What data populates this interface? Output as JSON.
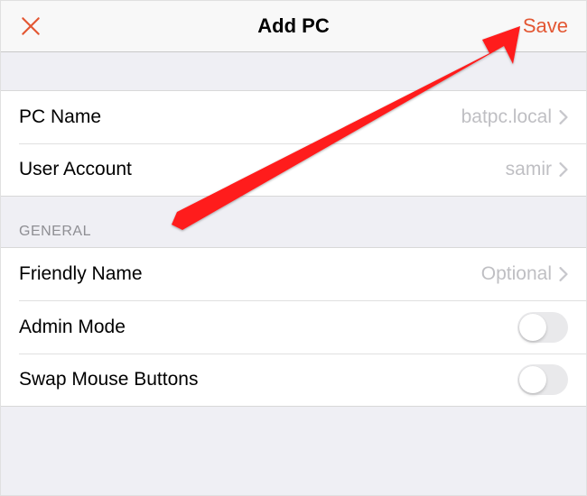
{
  "nav": {
    "title": "Add PC",
    "save": "Save",
    "accent_color": "#e35733"
  },
  "group1": {
    "items": [
      {
        "label": "PC Name",
        "value": "batpc.local"
      },
      {
        "label": "User Account",
        "value": "samir"
      }
    ]
  },
  "sections": {
    "general": "GENERAL"
  },
  "general": {
    "friendly_name": {
      "label": "Friendly Name",
      "placeholder": "Optional"
    },
    "admin_mode": {
      "label": "Admin Mode",
      "on": false
    },
    "swap_mouse": {
      "label": "Swap Mouse Buttons",
      "on": false
    }
  }
}
